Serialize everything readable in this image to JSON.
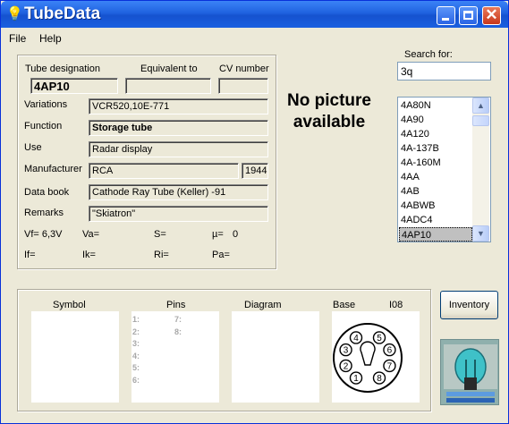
{
  "window": {
    "title": "TubeData"
  },
  "menu": {
    "file": "File",
    "help": "Help"
  },
  "search": {
    "label": "Search for:",
    "value": "3q"
  },
  "tube": {
    "designation_label": "Tube designation",
    "designation": "4AP10",
    "equivalent_label": "Equivalent to",
    "equivalent": "",
    "cv_label": "CV number",
    "cv": "",
    "variations_label": "Variations",
    "variations": "VCR520,10E-771",
    "function_label": "Function",
    "function": "Storage tube",
    "use_label": "Use",
    "use": "Radar display",
    "manufacturer_label": "Manufacturer",
    "manufacturer": "RCA",
    "year": "1944",
    "databook_label": "Data book",
    "databook": "Cathode Ray Tube (Keller) -91",
    "remarks_label": "Remarks",
    "remarks": "\"Skiatron\""
  },
  "params": {
    "vf": "Vf= 6,3V",
    "va": "Va=",
    "s": "S=",
    "mu": "µ=",
    "mu_value": "0",
    "if": "If=",
    "ik": "Ik=",
    "ri": "Ri=",
    "pa": "Pa="
  },
  "picture": {
    "no_picture": "No picture available"
  },
  "list": {
    "items": [
      "4A80N",
      "4A90",
      "4A120",
      "4A-137B",
      "4A-160M",
      "4AA",
      "4AB",
      "4ABWB",
      "4ADC4",
      "4AP10"
    ],
    "selected": "4AP10"
  },
  "bottom": {
    "symbol_label": "Symbol",
    "pins_label": "Pins",
    "diagram_label": "Diagram",
    "base_label": "Base",
    "base_value": "I08",
    "pins": [
      "1:",
      "2:",
      "3:",
      "4:",
      "5:",
      "6:",
      "7:",
      "8:"
    ],
    "socket_pins": [
      "1",
      "2",
      "3",
      "4",
      "5",
      "6",
      "7",
      "8"
    ]
  },
  "inventory_label": "Inventory",
  "colors": {
    "titlebar": "#1f62df",
    "face": "#ece9d8",
    "close": "#c8381c"
  }
}
